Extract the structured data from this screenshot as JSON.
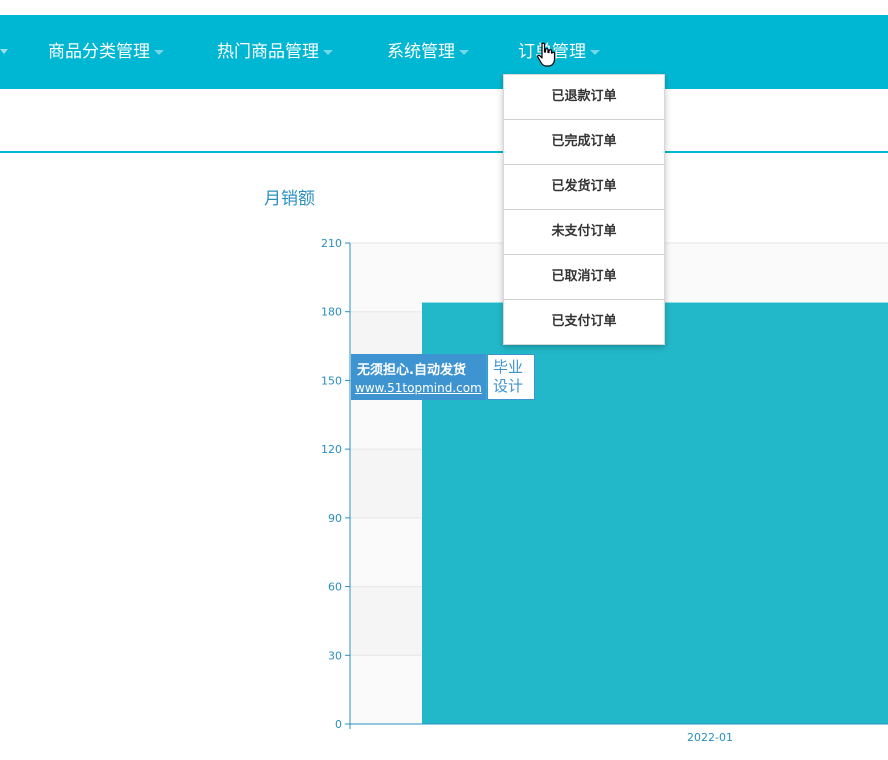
{
  "navbar": {
    "items": [
      {
        "label": "商品分类管理"
      },
      {
        "label": "热门商品管理"
      },
      {
        "label": "系统管理"
      },
      {
        "label": "订单管理"
      }
    ]
  },
  "dropdown": {
    "items": [
      {
        "label": "已退款订单"
      },
      {
        "label": "已完成订单"
      },
      {
        "label": "已发货订单"
      },
      {
        "label": "未支付订单"
      },
      {
        "label": "已取消订单"
      },
      {
        "label": "已支付订单"
      }
    ]
  },
  "watermark": {
    "line1": "无须担心.自动发货",
    "line2": "www.51topmind.com",
    "badge": "毕业设计"
  },
  "colors": {
    "navbar": "#00b7d3",
    "bar": "#22b8c9",
    "axis": "#2a8fc0"
  },
  "chart_data": {
    "type": "bar",
    "title": "月销额",
    "categories": [
      "2022-01"
    ],
    "values": [
      184
    ],
    "ylim": [
      0,
      210
    ],
    "yticks": [
      0,
      30,
      60,
      90,
      120,
      150,
      180,
      210
    ],
    "xlabel": "",
    "ylabel": "",
    "grid": true
  }
}
